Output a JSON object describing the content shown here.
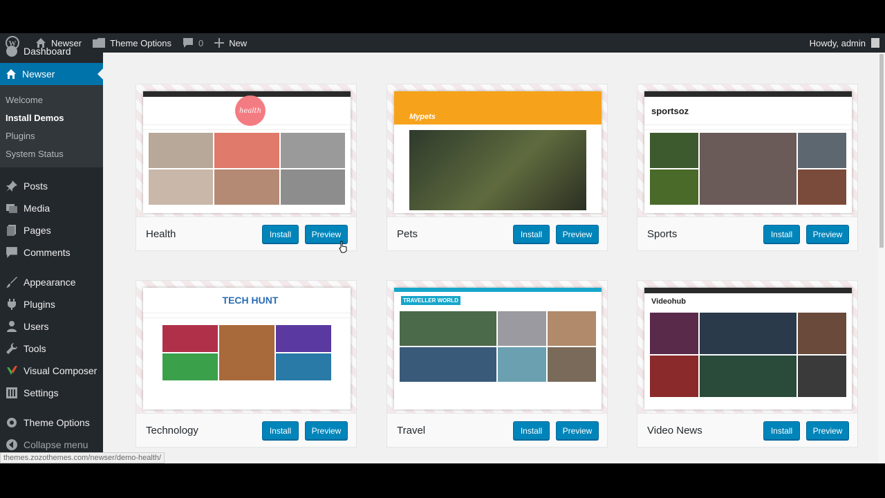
{
  "adminbar": {
    "site_name": "Newser",
    "theme_options": "Theme Options",
    "comments_count": "0",
    "new_label": "New",
    "howdy": "Howdy, admin"
  },
  "sidebar": {
    "dashboard": "Dashboard",
    "newser": "Newser",
    "submenu": [
      "Welcome",
      "Install Demos",
      "Plugins",
      "System Status"
    ],
    "items": [
      "Posts",
      "Media",
      "Pages",
      "Comments",
      "Appearance",
      "Plugins",
      "Users",
      "Tools",
      "Visual Composer",
      "Settings",
      "Theme Options",
      "Collapse menu"
    ]
  },
  "demos": [
    {
      "name": "Health",
      "install": "Install",
      "preview": "Preview",
      "brand": "health",
      "accent": "#f37c82"
    },
    {
      "name": "Pets",
      "install": "Install",
      "preview": "Preview",
      "brand": "Mypets",
      "accent": "#f7a21b"
    },
    {
      "name": "Sports",
      "install": "Install",
      "preview": "Preview",
      "brand": "sportsoz",
      "accent": "#e03b3b"
    },
    {
      "name": "Technology",
      "install": "Install",
      "preview": "Preview",
      "brand": "TECH HUNT",
      "accent": "#2b6cb3"
    },
    {
      "name": "Travel",
      "install": "Install",
      "preview": "Preview",
      "brand": "TRAVELLER WORLD",
      "accent": "#16a6c9"
    },
    {
      "name": "Video News",
      "install": "Install",
      "preview": "Preview",
      "brand": "Videohub",
      "accent": "#f7a21b"
    }
  ],
  "status_url": "themes.zozothemes.com/newser/demo-health/",
  "colors": {
    "primary": "#0085ba",
    "sidebar": "#23282d",
    "current": "#0073aa"
  }
}
